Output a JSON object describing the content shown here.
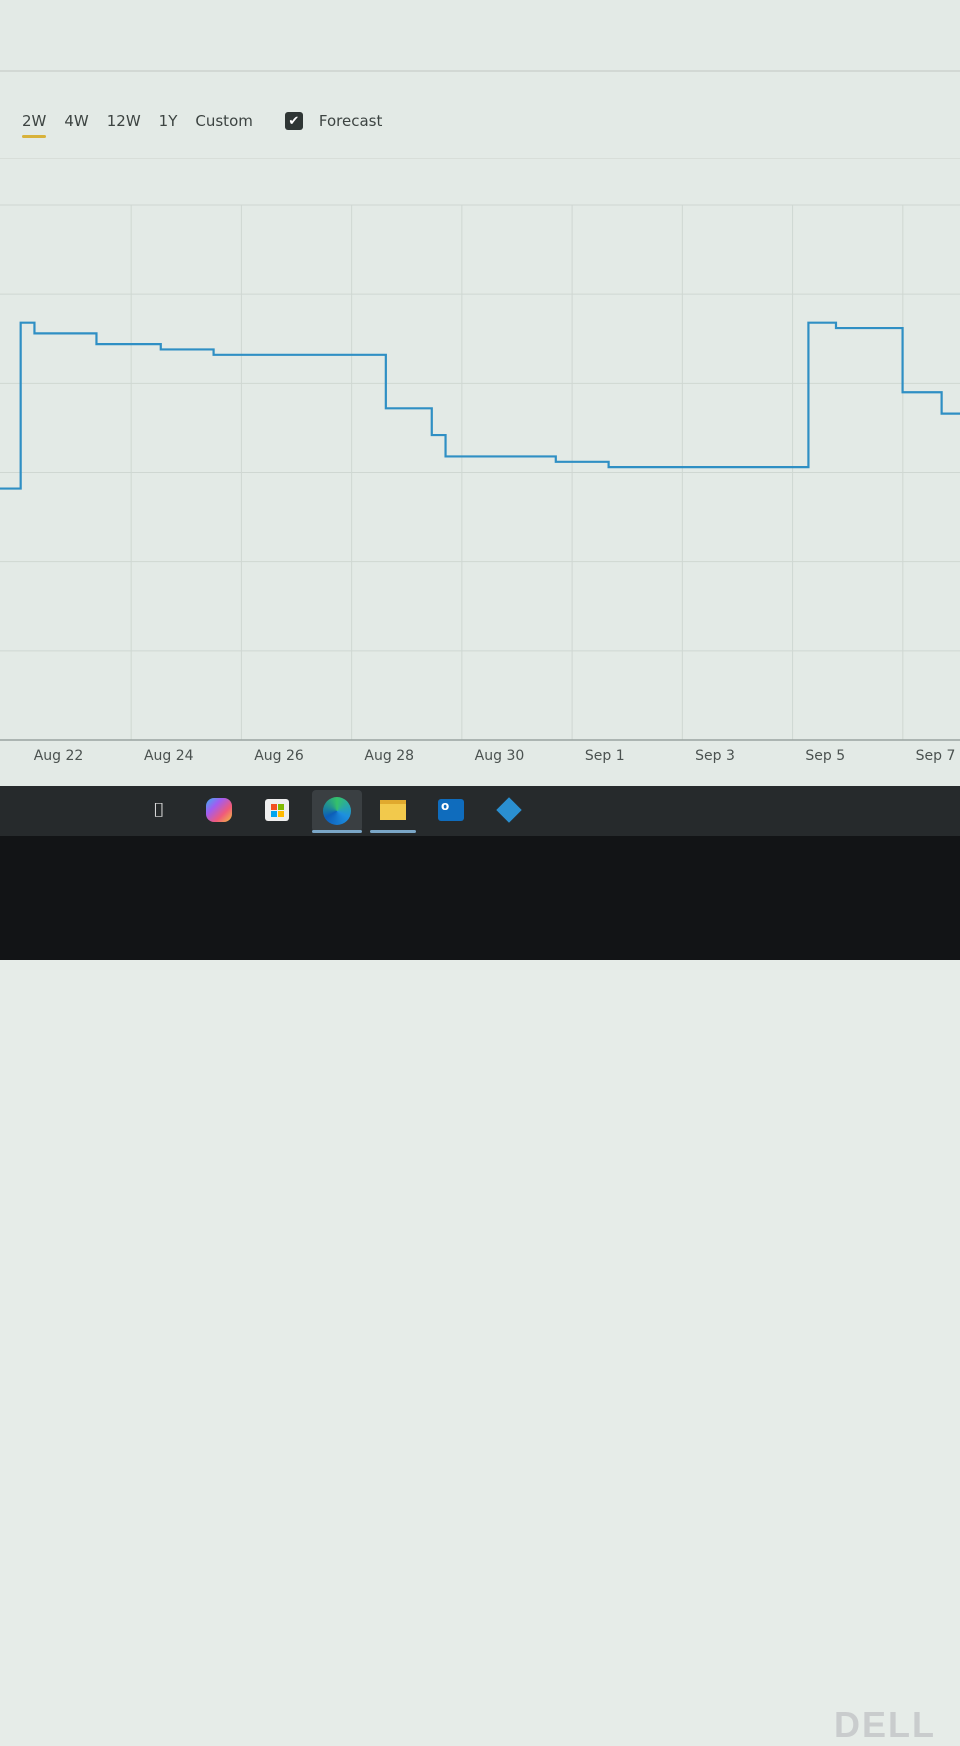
{
  "toolbar": {
    "ranges": [
      {
        "label": "2W",
        "active": true
      },
      {
        "label": "4W"
      },
      {
        "label": "12W"
      },
      {
        "label": "1Y"
      },
      {
        "label": "Custom"
      }
    ],
    "forecast": {
      "label": "Forecast",
      "checked": true
    }
  },
  "colors": {
    "line": "#2f8fc4",
    "accent": "#d8b23a",
    "grid": "#cfd7d2"
  },
  "chart_data": {
    "type": "line",
    "step": true,
    "title": "",
    "xlabel": "",
    "ylabel": "",
    "y_axis_labels_visible": false,
    "grid": true,
    "xlim": [
      "Aug 21 10:00",
      "Sep 7 20:00"
    ],
    "ylim": [
      0,
      100
    ],
    "x_ticks": [
      "Aug 22",
      "Aug 24",
      "Aug 26",
      "Aug 28",
      "Aug 30",
      "Sep 1",
      "Sep 3",
      "Sep 5",
      "Sep 7"
    ],
    "series": [
      {
        "points": [
          [
            "Aug 21 10:00",
            47
          ],
          [
            "Aug 21 19:00",
            78
          ],
          [
            "Aug 22 01:00",
            76
          ],
          [
            "Aug 23 04:00",
            74
          ],
          [
            "Aug 24 08:00",
            73
          ],
          [
            "Aug 25 07:00",
            72
          ],
          [
            "Aug 28 10:00",
            62
          ],
          [
            "Aug 29 06:00",
            57
          ],
          [
            "Aug 29 12:00",
            53
          ],
          [
            "Aug 31 12:00",
            52
          ],
          [
            "Sep 1 11:00",
            51
          ],
          [
            "Sep 5 02:00",
            78
          ],
          [
            "Sep 5 14:00",
            77
          ],
          [
            "Sep 6 19:00",
            65
          ],
          [
            "Sep 7 12:00",
            61
          ],
          [
            "Sep 7 20:00",
            61
          ]
        ]
      }
    ]
  },
  "taskbar": {
    "apps": [
      "task-view",
      "copilot",
      "microsoft-store",
      "edge",
      "file-explorer",
      "outlook",
      "app"
    ]
  },
  "bezel": {
    "logo": "DELL"
  }
}
